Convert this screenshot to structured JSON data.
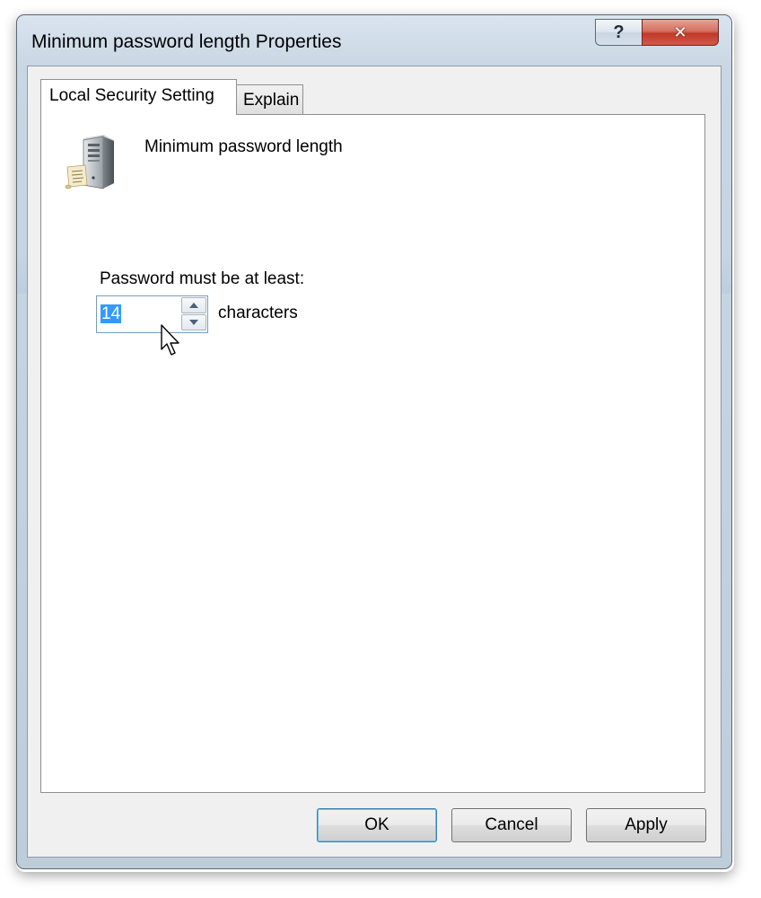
{
  "window": {
    "title": "Minimum password length Properties",
    "help_glyph": "?",
    "close_glyph": "✕"
  },
  "tabs": [
    {
      "label": "Local Security Setting",
      "active": true
    },
    {
      "label": "Explain",
      "active": false
    }
  ],
  "policy": {
    "icon": "server-policy-icon",
    "name": "Minimum password length"
  },
  "setting": {
    "label": "Password must be at least:",
    "value": "14",
    "unit": "characters"
  },
  "buttons": {
    "ok": "OK",
    "cancel": "Cancel",
    "apply": "Apply"
  },
  "colors": {
    "selection": "#3399ff",
    "close_button": "#c03a28",
    "default_button_border": "#3c7fb1"
  }
}
